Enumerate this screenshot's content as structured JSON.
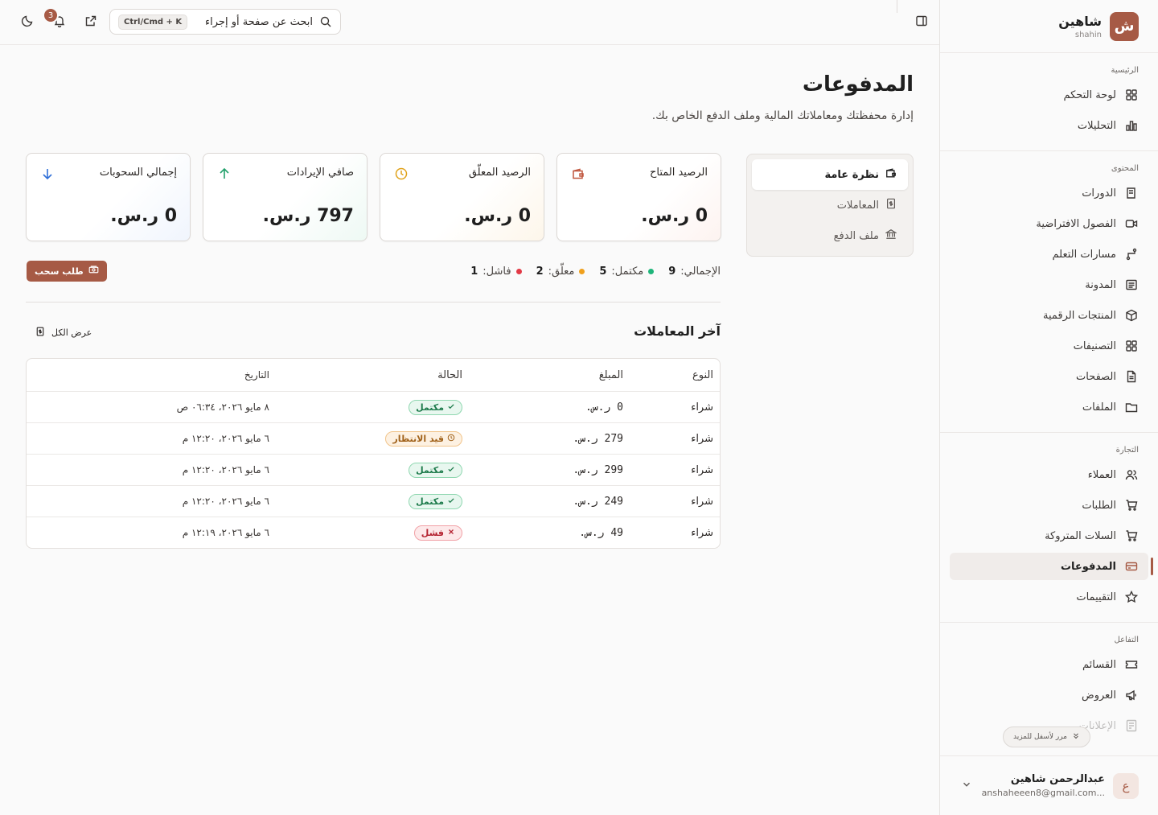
{
  "brand": {
    "logo_letter": "ش",
    "name": "شاهين",
    "subtitle": "shahin"
  },
  "sidebar": {
    "sections": [
      {
        "title": "الرئيسية",
        "items": [
          {
            "label": "لوحة التحكم",
            "icon": "grid-icon"
          },
          {
            "label": "التحليلات",
            "icon": "chart-icon"
          }
        ]
      },
      {
        "title": "المحتوى",
        "items": [
          {
            "label": "الدورات",
            "icon": "book-icon"
          },
          {
            "label": "الفصول الافتراضية",
            "icon": "video-icon"
          },
          {
            "label": "مسارات التعلم",
            "icon": "route-icon"
          },
          {
            "label": "المدونة",
            "icon": "newspaper-icon"
          },
          {
            "label": "المنتجات الرقمية",
            "icon": "package-icon"
          },
          {
            "label": "التصنيفات",
            "icon": "grid-icon"
          },
          {
            "label": "الصفحات",
            "icon": "file-icon"
          },
          {
            "label": "الملفات",
            "icon": "folder-icon"
          }
        ]
      },
      {
        "title": "التجارة",
        "items": [
          {
            "label": "العملاء",
            "icon": "users-icon"
          },
          {
            "label": "الطلبات",
            "icon": "cart-icon"
          },
          {
            "label": "السلات المتروكة",
            "icon": "cart-icon"
          },
          {
            "label": "المدفوعات",
            "icon": "credit-card-icon",
            "active": true
          },
          {
            "label": "التقييمات",
            "icon": "star-icon"
          }
        ]
      },
      {
        "title": "التفاعل",
        "items": [
          {
            "label": "القسائم",
            "icon": "ticket-icon"
          },
          {
            "label": "العروض",
            "icon": "megaphone-icon"
          },
          {
            "label": "الإعلانات",
            "icon": "ad-icon"
          }
        ]
      }
    ],
    "scroll_more": "مرر لأسفل للمزيد"
  },
  "user": {
    "avatar_letter": "ع",
    "name": "عبدالرحمن شاهين",
    "email": "anshaheeen8@gmail.com..."
  },
  "topbar": {
    "search_placeholder": "ابحث عن صفحة أو إجراء",
    "shortcut": "Ctrl/Cmd + K",
    "notification_count": "3"
  },
  "page": {
    "title": "المدفوعات",
    "subtitle": "إدارة محفظتك ومعاملاتك المالية وملف الدفع الخاص بك."
  },
  "tabs": [
    {
      "label": "نظرة عامة",
      "active": true
    },
    {
      "label": "المعاملات"
    },
    {
      "label": "ملف الدفع"
    }
  ],
  "cards": [
    {
      "label": "الرصيد المتاح",
      "value": "0 ر.س.",
      "icon": "wallet-icon",
      "color": "#c0573f"
    },
    {
      "label": "الرصيد المعلّق",
      "value": "0 ر.س.",
      "icon": "clock-icon",
      "color": "#e0a21a"
    },
    {
      "label": "صافي الإيرادات",
      "value": "797 ر.س.",
      "icon": "arrow-up-icon",
      "color": "#22a06b"
    },
    {
      "label": "إجمالي السحوبات",
      "value": "0 ر.س.",
      "icon": "arrow-down-icon",
      "color": "#2f6fd8"
    }
  ],
  "stats": {
    "total_label": "الإجمالي:",
    "total_value": "9",
    "completed_label": "مكتمل:",
    "completed_value": "5",
    "completed_color": "#1fb57a",
    "pending_label": "معلّق:",
    "pending_value": "2",
    "pending_color": "#f0a01c",
    "failed_label": "فاشل:",
    "failed_value": "1",
    "failed_color": "#e23a46"
  },
  "withdraw_button": "طلب سحب",
  "recent": {
    "title": "آخر المعاملات",
    "view_all": "عرض الكل",
    "columns": {
      "type": "النوع",
      "amount": "المبلغ",
      "status": "الحالة",
      "date": "التاريخ"
    },
    "rows": [
      {
        "type": "شراء",
        "amount": "0 ر.س.",
        "status": "مكتمل",
        "status_kind": "complete",
        "date": "٨ مايو ٢٠٢٦، ٠٦:٣٤ ص"
      },
      {
        "type": "شراء",
        "amount": "279 ر.س.",
        "status": "قيد الانتظار",
        "status_kind": "pending",
        "date": "٦ مايو ٢٠٢٦، ١٢:٢٠ م"
      },
      {
        "type": "شراء",
        "amount": "299 ر.س.",
        "status": "مكتمل",
        "status_kind": "complete",
        "date": "٦ مايو ٢٠٢٦، ١٢:٢٠ م"
      },
      {
        "type": "شراء",
        "amount": "249 ر.س.",
        "status": "مكتمل",
        "status_kind": "complete",
        "date": "٦ مايو ٢٠٢٦، ١٢:٢٠ م"
      },
      {
        "type": "شراء",
        "amount": "49 ر.س.",
        "status": "فشل",
        "status_kind": "failed",
        "date": "٦ مايو ٢٠٢٦، ١٢:١٩ م"
      }
    ]
  }
}
